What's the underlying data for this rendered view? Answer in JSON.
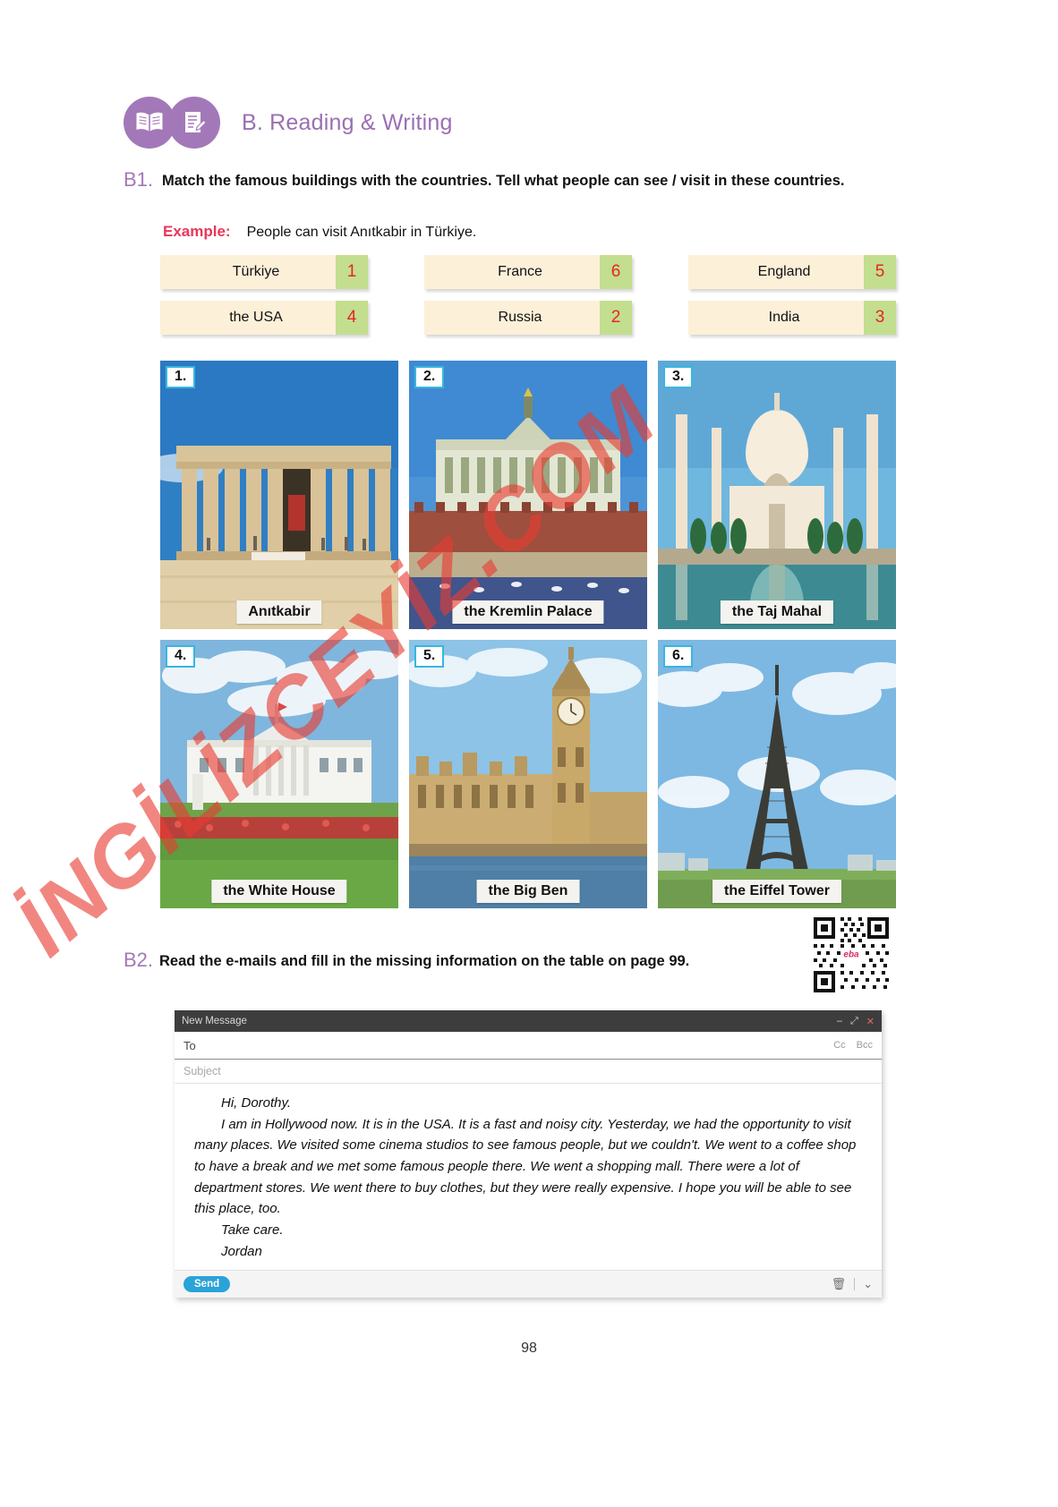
{
  "header": {
    "title": "B. Reading & Writing",
    "icon_left": "open-book-icon",
    "icon_right": "writing-pad-pencil-icon"
  },
  "exercises": {
    "b1": {
      "number": "B1.",
      "instruction": "Match the famous buildings with the countries. Tell what people can see / visit in these countries.",
      "example_label": "Example:",
      "example_text": "People can visit Anıtkabir in Türkiye."
    },
    "b2": {
      "number": "B2.",
      "instruction": "Read the e-mails and fill in the missing information on the table on page 99."
    }
  },
  "countries": [
    {
      "name": "Türkiye",
      "answer": "1"
    },
    {
      "name": "France",
      "answer": "6"
    },
    {
      "name": "England",
      "answer": "5"
    },
    {
      "name": "the USA",
      "answer": "4"
    },
    {
      "name": "Russia",
      "answer": "2"
    },
    {
      "name": "India",
      "answer": "3"
    }
  ],
  "photos": [
    {
      "badge": "1.",
      "caption": "Anıtkabir"
    },
    {
      "badge": "2.",
      "caption": "the Kremlin Palace"
    },
    {
      "badge": "3.",
      "caption": "the Taj Mahal"
    },
    {
      "badge": "4.",
      "caption": "the White House"
    },
    {
      "badge": "5.",
      "caption": "the Big Ben"
    },
    {
      "badge": "6.",
      "caption": "the Eiffel Tower"
    }
  ],
  "qr": {
    "label": "eba"
  },
  "mail": {
    "window_title": "New Message",
    "minimize": "–",
    "maximize": "⤢",
    "close": "✕",
    "to_label": "To",
    "cc_label": "Cc",
    "bcc_label": "Bcc",
    "subject_placeholder": "Subject",
    "body": {
      "greeting": "Hi, Dorothy.",
      "paragraph": "I am in Hollywood now. It is in the USA. It is a fast and noisy city. Yesterday, we had the opportunity to visit many places. We visited some cinema studios to see famous people, but we couldn't. We went to a coffee shop to have a break and we met some famous people there. We went a shopping mall. There were a lot of department stores. We went there to buy clothes, but they were really expensive. I hope you will be able to see this place, too.",
      "closing": "Take care.",
      "signature": "Jordan"
    },
    "send_label": "Send",
    "trash_icon": "trash-icon",
    "more_icon": "chevron-down-icon"
  },
  "watermark": "İNGİLİZCEYİZ.COM",
  "page_number": "98",
  "colors": {
    "accent_purple": "#9b6fb3",
    "country_box": "#fdf0d9",
    "answer_box": "#c3de8e",
    "answer_text": "#e8232a",
    "example_label": "#e8365a",
    "badge_border": "#37b6e0",
    "send_button": "#2aa3d8",
    "watermark": "#e83c32"
  }
}
